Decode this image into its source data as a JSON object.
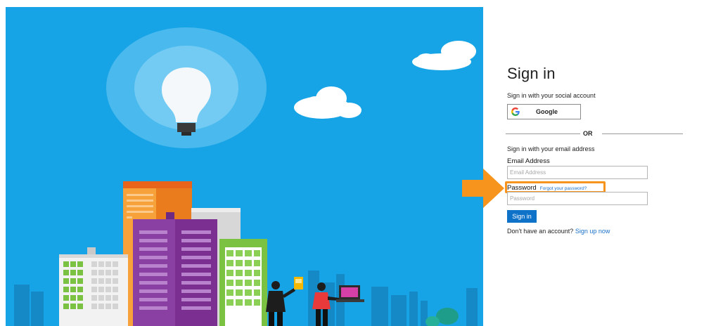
{
  "signin": {
    "title": "Sign in",
    "social_label": "Sign in with your social account",
    "google_label": "Google",
    "or_text": "OR",
    "email_section_label": "Sign in with your email address",
    "email_label": "Email Address",
    "email_placeholder": "Email Address",
    "email_value": "",
    "password_label": "Password",
    "forgot_link": "Forgot your password?",
    "password_placeholder": "Password",
    "password_value": "",
    "signin_button": "Sign in",
    "signup_prompt": "Don't have an account?",
    "signup_link": "Sign up now"
  },
  "icons": {
    "google": "google-g-icon",
    "arrow": "orange-right-arrow-icon"
  },
  "colors": {
    "hero_background": "#17a4e6",
    "primary_button": "#0f72c9",
    "link": "#1a6fc7",
    "highlight": "#f7941d"
  }
}
